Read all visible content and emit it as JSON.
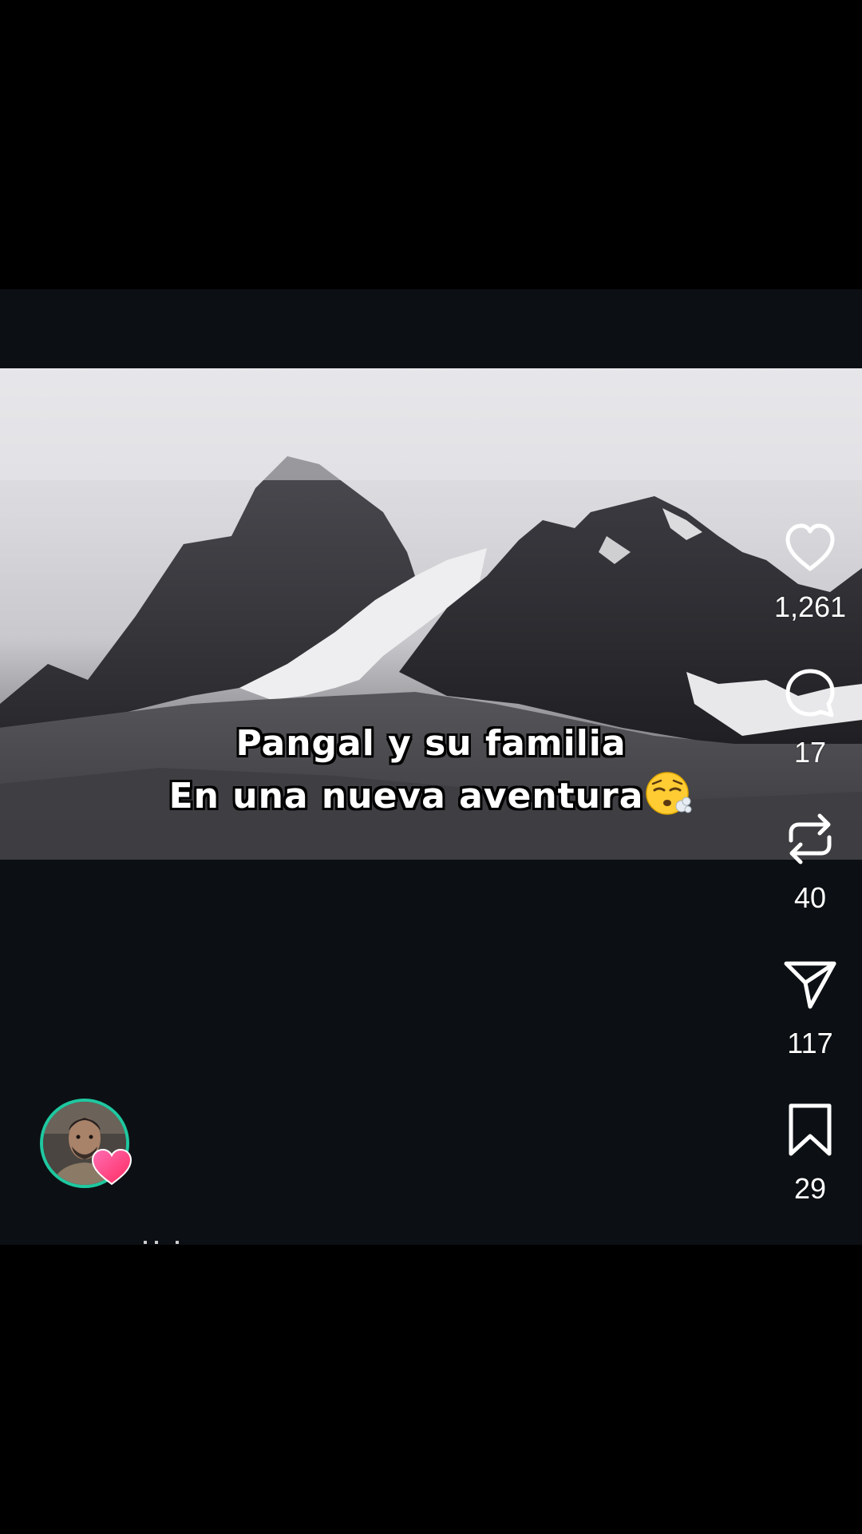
{
  "video": {
    "caption_line1": "Pangal y su familia",
    "caption_line2": "En una nueva aventura",
    "caption_emoji": "exhaling-face-emoji"
  },
  "actions": {
    "like": {
      "icon": "heart-outline-icon",
      "count": "1,261"
    },
    "comment": {
      "icon": "comment-bubble-icon",
      "count": "17"
    },
    "repost": {
      "icon": "repost-arrows-icon",
      "count": "40"
    },
    "share": {
      "icon": "paper-plane-icon",
      "count": "117"
    },
    "save": {
      "icon": "bookmark-icon",
      "count": "29"
    }
  },
  "profile": {
    "avatar": "profile-avatar",
    "badge_icon": "pink-heart-icon",
    "ring_color": "#1fc8a0"
  },
  "colors": {
    "background": "#000000",
    "reel_background": "#0c1014",
    "icon": "#ffffff"
  }
}
